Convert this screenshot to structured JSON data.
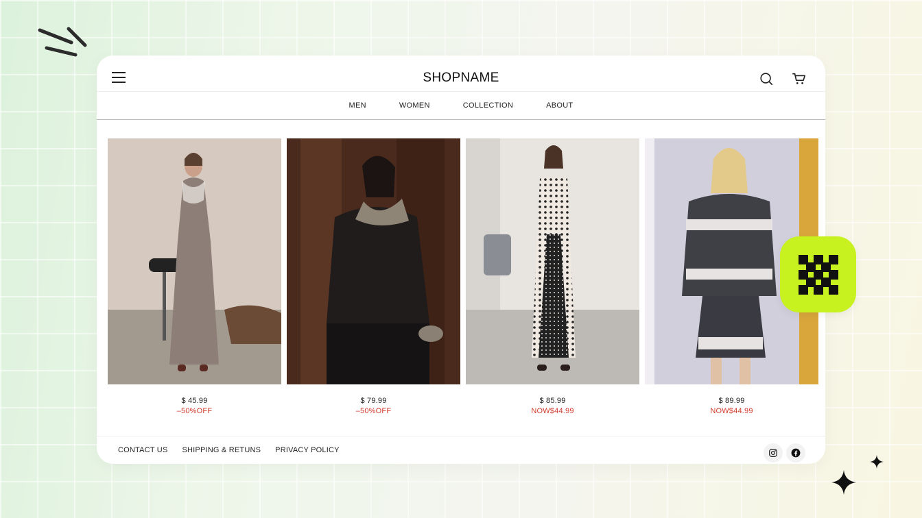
{
  "header": {
    "title": "SHOPNAME",
    "menu_icon": "hamburger-menu-icon",
    "search_icon": "search-icon",
    "cart_icon": "shopping-cart-icon"
  },
  "nav": {
    "items": [
      {
        "label": "MEN"
      },
      {
        "label": "WOMEN"
      },
      {
        "label": "COLLECTION"
      },
      {
        "label": "ABOUT"
      }
    ]
  },
  "products": [
    {
      "price": "$ 45.99",
      "promo": "–50%OFF",
      "image": "model in grey ribbed knit dress"
    },
    {
      "price": "$ 79.99",
      "promo": "–50%OFF",
      "image": "model in black leather shearling jacket"
    },
    {
      "price": "$ 85.99",
      "promo": "NOW$44.99",
      "image": "model in polka dot slip dress"
    },
    {
      "price": "$ 89.99",
      "promo": "NOW$44.99",
      "image": "model in knit cardigan and skirt set"
    }
  ],
  "footer": {
    "links": [
      {
        "label": "CONTACT US"
      },
      {
        "label": "SHIPPING & RETUNS"
      },
      {
        "label": "PRIVACY POLICY"
      }
    ],
    "social": [
      "instagram-icon",
      "facebook-icon"
    ]
  },
  "colors": {
    "accent": "#c8f21f",
    "promo": "#d23a2c",
    "text": "#222222"
  }
}
